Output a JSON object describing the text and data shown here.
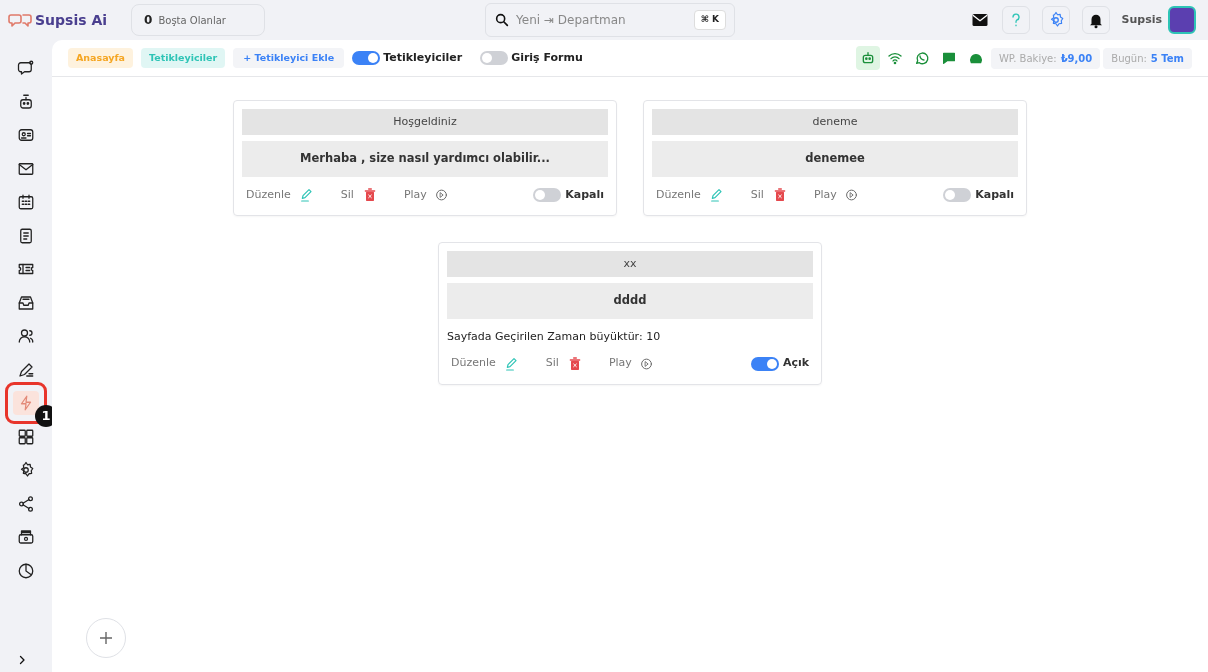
{
  "header": {
    "logo": "Supsis Ai",
    "idle": {
      "count": "0",
      "label": "Boşta Olanlar"
    },
    "search": {
      "value": "Yeni ⇥ Departman",
      "shortcut": "⌘ K"
    },
    "user": "Supsis"
  },
  "sidebar": {
    "items": [
      {
        "selected": false
      },
      {
        "selected": false
      },
      {
        "selected": false
      },
      {
        "selected": false
      },
      {
        "selected": false
      },
      {
        "selected": false
      },
      {
        "selected": false
      },
      {
        "selected": false
      },
      {
        "selected": false
      },
      {
        "selected": false
      },
      {
        "selected": true
      },
      {
        "selected": false
      },
      {
        "selected": false
      },
      {
        "selected": false
      },
      {
        "selected": false
      },
      {
        "selected": false
      }
    ],
    "annotation": {
      "badge": "1"
    }
  },
  "toolbar": {
    "breadcrumbs": [
      {
        "label": "Anasayfa",
        "color": "#f5a623"
      },
      {
        "label": "Tetikleyiciler",
        "color": "#2ec4b6"
      }
    ],
    "add_button": "+ Tetikleyici Ekle",
    "toggles": [
      {
        "label": "Tetikleyiciler",
        "on": true
      },
      {
        "label": "Giriş Formu",
        "on": false
      }
    ],
    "balance": {
      "label": "WP. Bakiye:",
      "value": "₺9,00"
    },
    "today": {
      "label": "Bugün:",
      "value": "5 Tem"
    }
  },
  "triggers": [
    {
      "title": "Hoşgeldiniz",
      "message": "Merhaba , size nasıl yardımcı olabilir...",
      "actions": [
        "Düzenle",
        "Sil",
        "Play"
      ],
      "on": false,
      "status": "Kapalı"
    },
    {
      "title": "deneme",
      "message": "denemee",
      "actions": [
        "Düzenle",
        "Sil",
        "Play"
      ],
      "on": false,
      "status": "Kapalı"
    },
    {
      "title": "xx",
      "message": "dddd",
      "condition": "Sayfada Geçirilen Zaman büyüktür: 10",
      "actions": [
        "Düzenle",
        "Sil",
        "Play"
      ],
      "on": true,
      "status": "Açık"
    }
  ]
}
